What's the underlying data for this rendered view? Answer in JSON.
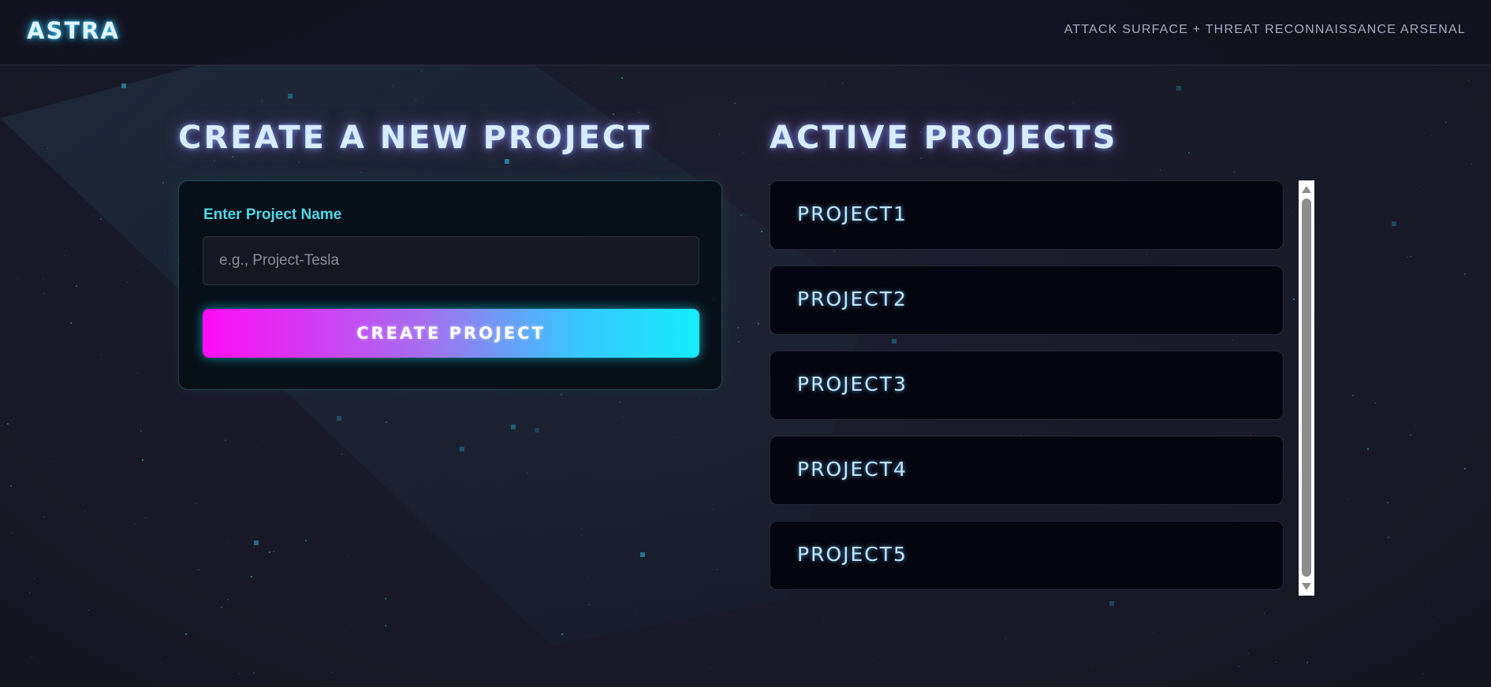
{
  "header": {
    "logo": "ASTRA",
    "tagline": "ATTACK SURFACE + THREAT RECONNAISSANCE ARSENAL"
  },
  "create_section": {
    "title": "CREATE A NEW PROJECT",
    "field_label": "Enter Project Name",
    "input_value": "",
    "input_placeholder": "e.g., Project-Tesla",
    "button_label": "CREATE PROJECT"
  },
  "projects_section": {
    "title": "ACTIVE PROJECTS",
    "items": [
      {
        "name": "PROJECT1"
      },
      {
        "name": "PROJECT2"
      },
      {
        "name": "PROJECT3"
      },
      {
        "name": "PROJECT4"
      },
      {
        "name": "PROJECT5"
      }
    ]
  },
  "colors": {
    "background": "#181826",
    "accent_cyan": "#16ecfb",
    "accent_magenta": "#ff0cf6",
    "label_cyan": "#4fd8e8",
    "card_background": "#05050f"
  },
  "icons": {
    "scroll_up": "triangle-up-icon",
    "scroll_down": "triangle-down-icon"
  }
}
